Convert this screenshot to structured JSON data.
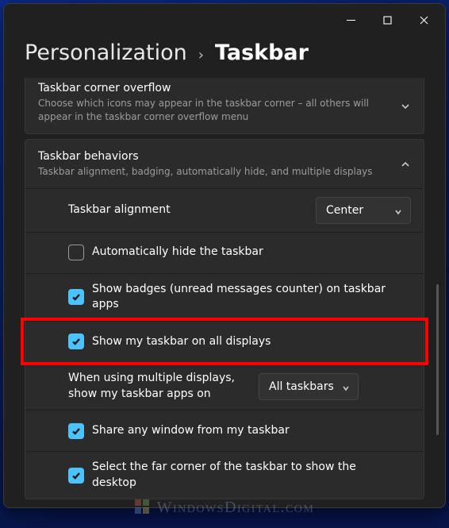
{
  "breadcrumb": {
    "parent": "Personalization",
    "current": "Taskbar"
  },
  "overflow_section": {
    "title": "Taskbar corner overflow",
    "subtitle": "Choose which icons may appear in the taskbar corner – all others will appear in the taskbar corner overflow menu"
  },
  "behaviors_section": {
    "title": "Taskbar behaviors",
    "subtitle": "Taskbar alignment, badging, automatically hide, and multiple displays",
    "rows": {
      "alignment": {
        "label": "Taskbar alignment",
        "value": "Center"
      },
      "auto_hide": {
        "label": "Automatically hide the taskbar",
        "checked": false
      },
      "badges": {
        "label": "Show badges (unread messages counter) on taskbar apps",
        "checked": true
      },
      "all_disp": {
        "label": "Show my taskbar on all displays",
        "checked": true
      },
      "multi": {
        "label": "When using multiple displays, show my taskbar apps on",
        "value": "All taskbars"
      },
      "share": {
        "label": "Share any window from my taskbar",
        "checked": true
      },
      "corner": {
        "label": "Select the far corner of the taskbar to show the desktop",
        "checked": true
      }
    }
  },
  "watermark": "WindowsDigital.com"
}
